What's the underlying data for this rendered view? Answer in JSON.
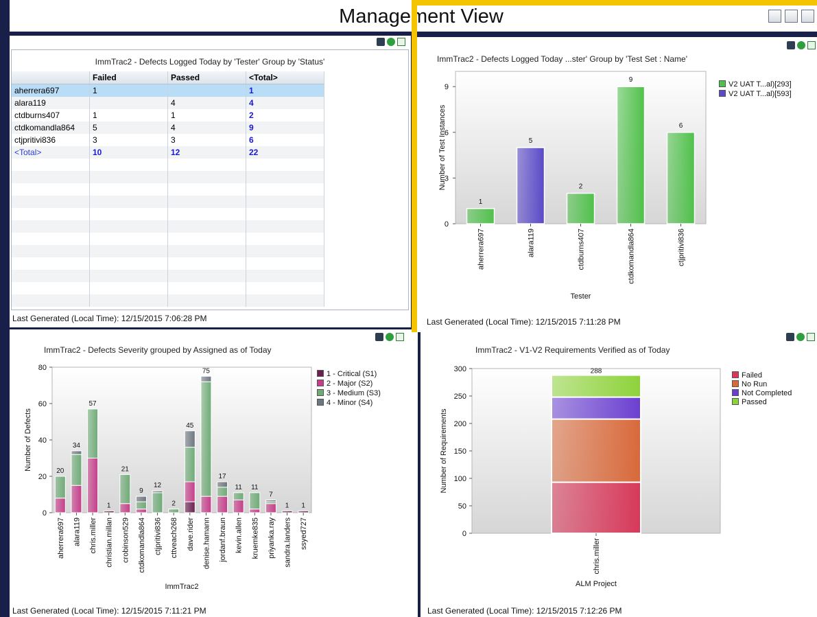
{
  "page": {
    "title": "Management View"
  },
  "grid_panel": {
    "title": "ImmTrac2 - Defects Logged Today  by 'Tester' Group by 'Status'",
    "columns": [
      "",
      "Failed",
      "Passed",
      "<Total>"
    ],
    "rows": [
      [
        "aherrera697",
        "1",
        "",
        "1"
      ],
      [
        "alara119",
        "",
        "4",
        "4"
      ],
      [
        "ctdburns407",
        "1",
        "1",
        "2"
      ],
      [
        "ctdkomandla864",
        "5",
        "4",
        "9"
      ],
      [
        "ctjpritivi836",
        "3",
        "3",
        "6"
      ],
      [
        "<Total>",
        "10",
        "12",
        "22"
      ]
    ],
    "footer": "Last Generated (Local Time): 12/15/2015 7:06:28 PM"
  },
  "tester_panel": {
    "title": "ImmTrac2 - Defects Logged Today ...ster' Group by 'Test Set : Name'",
    "footer": "Last Generated (Local Time): 12/15/2015 7:11:28 PM",
    "highlight_color": "#f5c400"
  },
  "severity_panel": {
    "title": "ImmTrac2 - Defects Severity grouped by Assigned as of Today",
    "footer": "Last Generated (Local Time): 12/15/2015 7:11:21 PM"
  },
  "requirements_panel": {
    "title": "ImmTrac2 - V1-V2 Requirements Verified as of Today",
    "footer": "Last Generated (Local Time): 12/15/2015 7:12:26 PM"
  },
  "chart_data": [
    {
      "type": "bar",
      "title": "ImmTrac2 - Defects Logged Today ...ster' Group by 'Test Set : Name'",
      "xlabel": "Tester",
      "ylabel": "Number of Test Instances",
      "ylim": [
        0,
        10
      ],
      "yticks": [
        0,
        3,
        6,
        9
      ],
      "categories": [
        "aherrera697",
        "alara119",
        "ctdburns407",
        "ctdkomandla864",
        "ctjpritivi836"
      ],
      "values": [
        1,
        5,
        2,
        9,
        6
      ],
      "series_index": [
        0,
        1,
        0,
        0,
        0
      ],
      "series": [
        {
          "name": "V2 UAT T...al)[293]",
          "color": "#4fc14a"
        },
        {
          "name": "V2 UAT T...al)[593]",
          "color": "#5a49c8"
        }
      ],
      "legend": "right",
      "grid": false
    },
    {
      "type": "bar",
      "stacked": true,
      "title": "ImmTrac2 - Defects Severity grouped by Assigned as of Today",
      "xlabel": "ImmTrac2",
      "ylabel": "Number of Defects",
      "ylim": [
        0,
        80
      ],
      "yticks": [
        0,
        20,
        40,
        60,
        80
      ],
      "categories": [
        "aherrera697",
        "alara119",
        "chris.miller",
        "christian.millan",
        "crobinson529",
        "ctdkomandla864",
        "ctjpritivi836",
        "cttveach268",
        "dave.rider",
        "denise.hamann",
        "jordanf.braun",
        "kevin.allen",
        "kruemke835",
        "priyanka.ray",
        "sandra.landers",
        "ssyed727"
      ],
      "totals": [
        20,
        34,
        57,
        1,
        21,
        9,
        12,
        2,
        45,
        75,
        17,
        11,
        11,
        7,
        1,
        1
      ],
      "series": [
        {
          "name": "1 - Critical (S1)",
          "color": "#6b1f4f",
          "values": [
            0,
            0,
            0,
            1,
            0,
            0,
            0,
            0,
            6,
            0,
            0,
            0,
            0,
            0,
            1,
            1
          ]
        },
        {
          "name": "2 - Major (S2)",
          "color": "#c63d8a",
          "values": [
            8,
            15,
            30,
            0,
            5,
            2,
            0,
            0,
            11,
            9,
            9,
            7,
            2,
            5,
            0,
            0
          ]
        },
        {
          "name": "3 - Medium (S3)",
          "color": "#6fab77",
          "values": [
            12,
            17,
            27,
            0,
            16,
            4,
            11,
            2,
            19,
            63,
            5,
            4,
            9,
            1,
            0,
            0
          ]
        },
        {
          "name": "4 - Minor (S4)",
          "color": "#6d7780",
          "values": [
            0,
            2,
            0,
            0,
            0,
            3,
            1,
            0,
            9,
            3,
            3,
            0,
            0,
            1,
            0,
            0
          ]
        }
      ],
      "legend": "right",
      "grid": false
    },
    {
      "type": "bar",
      "stacked": true,
      "title": "ImmTrac2 - V1-V2 Requirements Verified as of Today",
      "xlabel": "ALM Project",
      "ylabel": "Number of Requirements",
      "ylim": [
        0,
        300
      ],
      "yticks": [
        0,
        50,
        100,
        150,
        200,
        250,
        300
      ],
      "categories": [
        "chris.miller"
      ],
      "totals": [
        288
      ],
      "series": [
        {
          "name": "Failed",
          "color": "#d8385a",
          "values": [
            93
          ]
        },
        {
          "name": "No Run",
          "color": "#d8693a",
          "values": [
            115
          ]
        },
        {
          "name": "Not Completed",
          "color": "#6a3fd0",
          "values": [
            40
          ]
        },
        {
          "name": "Passed",
          "color": "#8dd23a",
          "values": [
            40
          ]
        }
      ],
      "legend": "right",
      "grid": false
    }
  ]
}
